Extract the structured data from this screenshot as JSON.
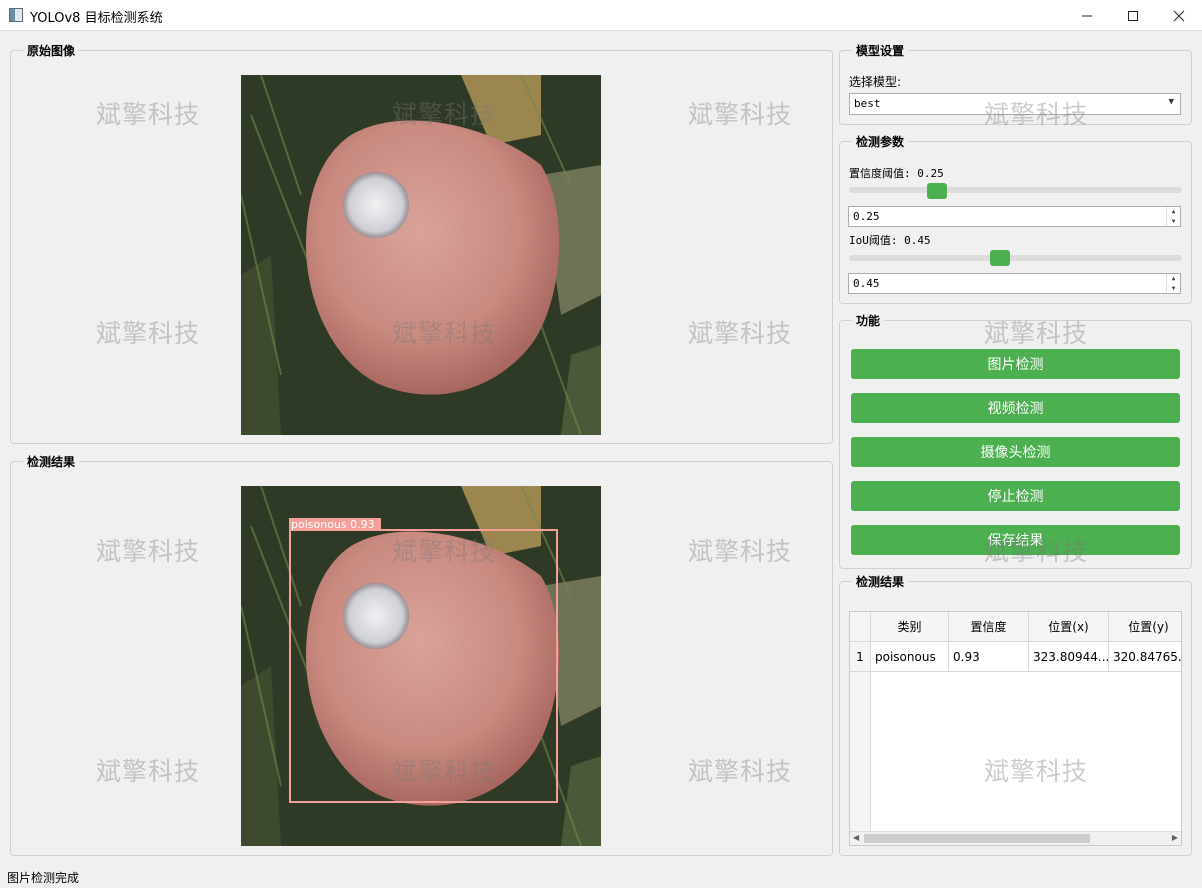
{
  "window": {
    "title": "YOLOv8 目标检测系统",
    "minimize_icon": "minimize-icon",
    "maximize_icon": "maximize-icon",
    "close_icon": "close-icon"
  },
  "original_panel": {
    "title": "原始图像"
  },
  "result_panel": {
    "title": "检测结果",
    "detection_label": "poisonous  0.93",
    "box_color": "#f4a09a"
  },
  "model_settings": {
    "title": "模型设置",
    "select_label": "选择模型:",
    "selected_model": "best"
  },
  "detection_params": {
    "title": "检测参数",
    "conf_label": "置信度阈值: 0.25",
    "conf_value": "0.25",
    "conf_slider_fraction": 0.25,
    "iou_label": "IoU阈值: 0.45",
    "iou_value": "0.45",
    "iou_slider_fraction": 0.45
  },
  "functions": {
    "title": "功能",
    "buttons": [
      "图片检测",
      "视频检测",
      "摄像头检测",
      "停止检测",
      "保存结果"
    ],
    "accent_color": "#4caf50"
  },
  "results_table": {
    "title": "检测结果",
    "columns": [
      "类别",
      "置信度",
      "位置(x)",
      "位置(y)"
    ],
    "rows": [
      {
        "index": "1",
        "cells": [
          "poisonous",
          "0.93",
          "323.80944...",
          "320.84765..."
        ]
      }
    ]
  },
  "watermark": "斌擎科技",
  "status_bar": {
    "text": "图片检测完成"
  }
}
